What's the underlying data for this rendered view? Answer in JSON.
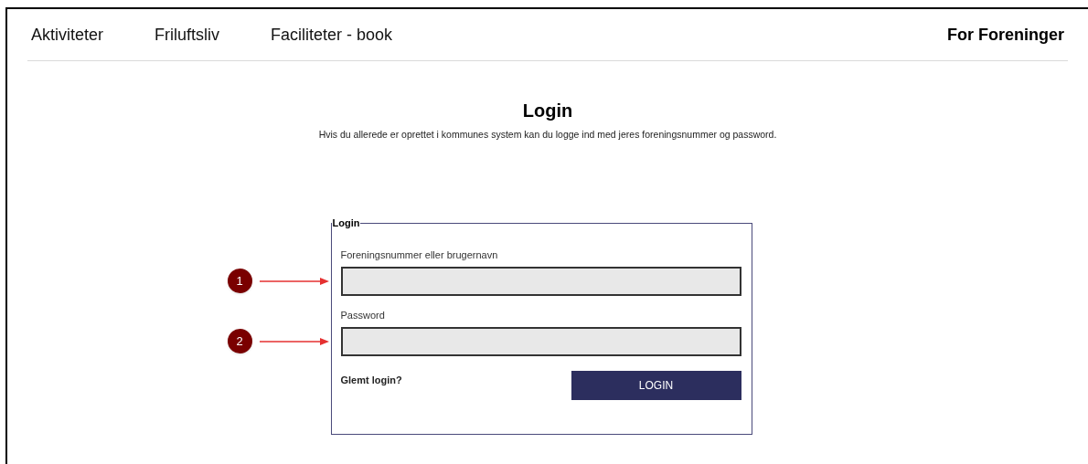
{
  "nav": {
    "items": [
      {
        "label": "Aktiviteter"
      },
      {
        "label": "Friluftsliv"
      },
      {
        "label": "Faciliteter - book"
      }
    ],
    "right_link": "For Foreninger"
  },
  "heading": {
    "title": "Login",
    "subtitle": "Hvis du allerede er oprettet i kommunes system kan du logge ind med jeres foreningsnummer og password."
  },
  "form": {
    "legend": "Login",
    "fields": [
      {
        "label": "Foreningsnummer eller brugernavn",
        "callout": "1"
      },
      {
        "label": "Password",
        "callout": "2"
      }
    ],
    "forgot_link": "Glemt login?",
    "submit": "LOGIN"
  }
}
